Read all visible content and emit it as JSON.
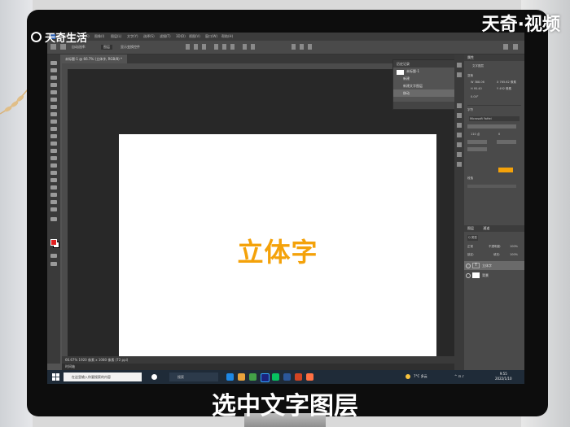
{
  "branding": {
    "top_left": "天奇生活",
    "top_right": "天奇·视频"
  },
  "subtitle": "选中文字图层",
  "photoshop": {
    "menu": [
      "文件(F)",
      "编辑(E)",
      "图像(I)",
      "图层(L)",
      "文字(Y)",
      "选择(S)",
      "滤镜(T)",
      "3D(D)",
      "视图(V)",
      "窗口(W)",
      "帮助(H)"
    ],
    "options": {
      "auto_select": "自动选择:",
      "layer_select": "图层",
      "show_transform": "显示变换控件"
    },
    "doc_tab": "未标题-1 @ 66.7% (立体字, RGB/8) *",
    "canvas_text": "立体字",
    "status": "66.67%   1920 像素 x 1080 像素 (72 ppi)",
    "timeline": "时间轴",
    "history_panel": {
      "title": "历史记录",
      "snapshot": "未标题-1",
      "items": [
        "新建",
        "新建文字图层",
        "移动"
      ]
    },
    "properties_panel": {
      "title": "属性",
      "sub": "文字图层",
      "transform": "变换",
      "w": "W 388.06",
      "h": "H 95.40",
      "x": "X 765.62 像素",
      "y": "Y 492 像素",
      "angle": "0.00°",
      "char_title": "字符",
      "font": "Microsoft YaHei",
      "size": "110 点",
      "tracking": "0",
      "para_title": "段落"
    },
    "layers_panel": {
      "tabs": [
        "图层",
        "通道"
      ],
      "kind": "Q 类型",
      "blend": "正常",
      "opacity_label": "不透明度:",
      "opacity": "100%",
      "lock": "锁定:",
      "fill_label": "填充:",
      "fill": "100%",
      "layers": [
        {
          "name": "立体字",
          "type": "text"
        },
        {
          "name": "背景",
          "type": "image"
        }
      ]
    },
    "colors": {
      "text": "#f4a20a",
      "foreground": "#e02020",
      "background": "#ffffff"
    }
  },
  "taskbar": {
    "search_placeholder": "在这里输入你要搜索的内容",
    "mid_search": "搜索",
    "weather": "7°C 多云",
    "time": "9:55",
    "date": "2022/1/10"
  }
}
